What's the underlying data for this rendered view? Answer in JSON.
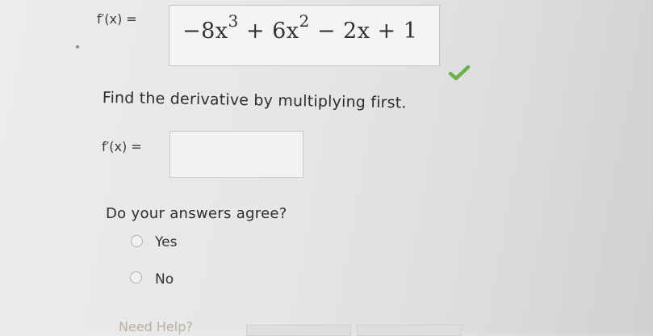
{
  "row1": {
    "label": "f′(x) =",
    "expression_parts": {
      "t1_coef": "−8x",
      "t1_exp": "3",
      "t2": "+ 6x",
      "t2_exp": "2",
      "t3": "− 2x",
      "t4": "+ 1"
    },
    "status_icon": "checkmark-icon",
    "status_color": "#6ab04c"
  },
  "instruction": "Find the derivative by multiplying first.",
  "row2": {
    "label": "f′(x) =",
    "input_value": ""
  },
  "question": "Do your answers agree?",
  "options": [
    {
      "label": "Yes",
      "selected": false
    },
    {
      "label": "No",
      "selected": false
    }
  ],
  "footer": {
    "need_help": "Need Help?"
  }
}
